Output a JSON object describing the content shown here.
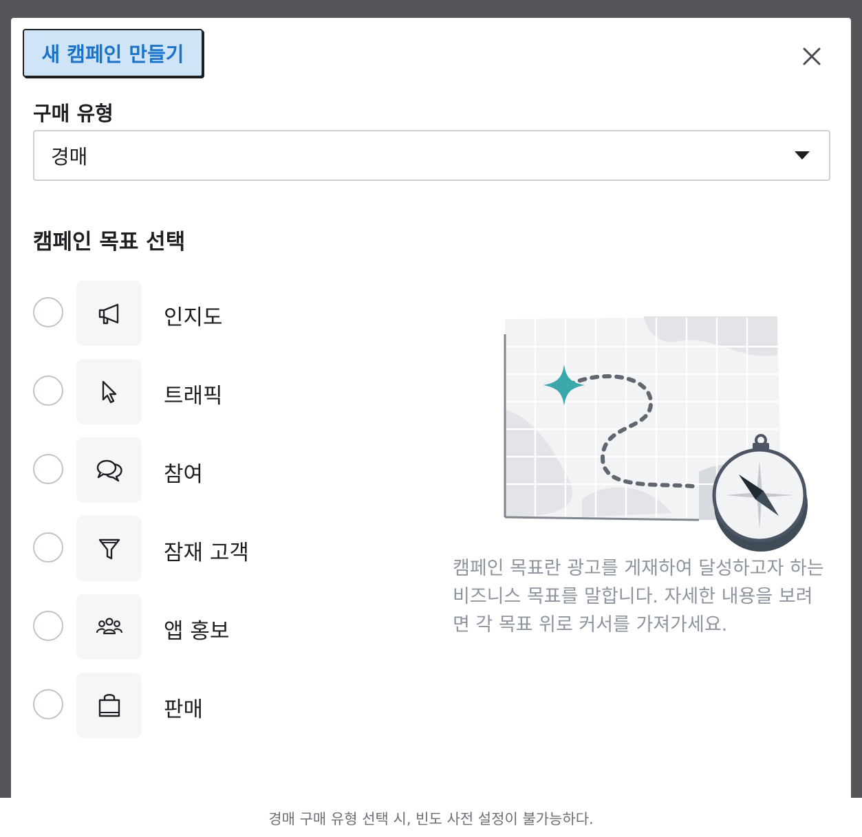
{
  "modal": {
    "title": "새 캠페인 만들기",
    "close_icon": "close-icon"
  },
  "purchase_type": {
    "label": "구매 유형",
    "selected": "경매"
  },
  "goal": {
    "label": "캠페인 목표 선택",
    "options": [
      {
        "label": "인지도",
        "icon": "megaphone-icon"
      },
      {
        "label": "트래픽",
        "icon": "cursor-icon"
      },
      {
        "label": "참여",
        "icon": "chat-bubbles-icon"
      },
      {
        "label": "잠재 고객",
        "icon": "funnel-icon"
      },
      {
        "label": "앱 홍보",
        "icon": "people-icon"
      },
      {
        "label": "판매",
        "icon": "shopping-bag-icon"
      }
    ],
    "description": "캠페인 목표란 광고를 게재하여 달성하고자 하는 비즈니스 목표를 말합니다. 자세한 내용을 보려면 각 목표 위로 커서를 가져가세요."
  },
  "caption": "경매 구매 유형 선택 시, 빈도 사전 설정이 불가능하다.",
  "colors": {
    "accent": "#1a73c8",
    "title_bg": "#cfe4f7",
    "teal": "#3aa8a8"
  }
}
